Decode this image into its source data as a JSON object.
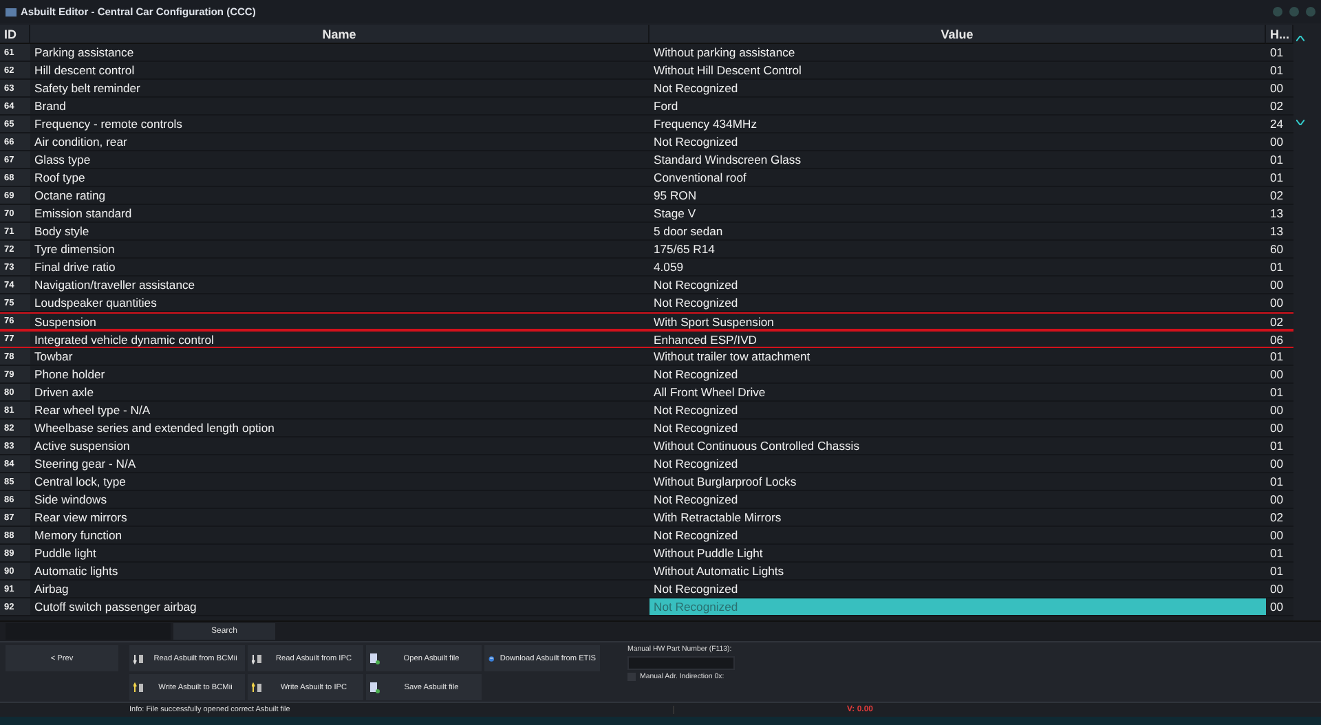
{
  "window": {
    "title": "Asbuilt Editor - Central Car Configuration (CCC)"
  },
  "table": {
    "columns": [
      "ID",
      "Name",
      "Value",
      "H..."
    ],
    "rows": [
      {
        "id": "61",
        "name": "Parking assistance",
        "value": "Without parking assistance",
        "hex": "01",
        "selected": false,
        "highlighted": false
      },
      {
        "id": "62",
        "name": "Hill descent control",
        "value": "Without Hill Descent Control",
        "hex": "01",
        "selected": false,
        "highlighted": false
      },
      {
        "id": "63",
        "name": "Safety belt reminder",
        "value": "Not Recognized",
        "hex": "00",
        "selected": false,
        "highlighted": false
      },
      {
        "id": "64",
        "name": "Brand",
        "value": "Ford",
        "hex": "02",
        "selected": false,
        "highlighted": false
      },
      {
        "id": "65",
        "name": "Frequency - remote controls",
        "value": "Frequency 434MHz",
        "hex": "24",
        "selected": false,
        "highlighted": false
      },
      {
        "id": "66",
        "name": "Air condition, rear",
        "value": "Not Recognized",
        "hex": "00",
        "selected": false,
        "highlighted": false
      },
      {
        "id": "67",
        "name": "Glass type",
        "value": "Standard Windscreen Glass",
        "hex": "01",
        "selected": false,
        "highlighted": false
      },
      {
        "id": "68",
        "name": "Roof type",
        "value": "Conventional roof",
        "hex": "01",
        "selected": false,
        "highlighted": false
      },
      {
        "id": "69",
        "name": "Octane rating",
        "value": "95 RON",
        "hex": "02",
        "selected": false,
        "highlighted": false
      },
      {
        "id": "70",
        "name": "Emission standard",
        "value": "Stage V",
        "hex": "13",
        "selected": false,
        "highlighted": false
      },
      {
        "id": "71",
        "name": "Body style",
        "value": "5 door sedan",
        "hex": "13",
        "selected": false,
        "highlighted": false
      },
      {
        "id": "72",
        "name": "Tyre dimension",
        "value": "175/65 R14",
        "hex": "60",
        "selected": false,
        "highlighted": false
      },
      {
        "id": "73",
        "name": "Final drive ratio",
        "value": "4.059",
        "hex": "01",
        "selected": false,
        "highlighted": false
      },
      {
        "id": "74",
        "name": "Navigation/traveller assistance",
        "value": "Not Recognized",
        "hex": "00",
        "selected": false,
        "highlighted": false
      },
      {
        "id": "75",
        "name": "Loudspeaker quantities",
        "value": "Not Recognized",
        "hex": "00",
        "selected": false,
        "highlighted": false
      },
      {
        "id": "76",
        "name": "Suspension",
        "value": "With Sport Suspension",
        "hex": "02",
        "selected": false,
        "highlighted": true
      },
      {
        "id": "77",
        "name": "Integrated vehicle dynamic control",
        "value": "Enhanced ESP/IVD",
        "hex": "06",
        "selected": false,
        "highlighted": true
      },
      {
        "id": "78",
        "name": "Towbar",
        "value": "Without trailer tow attachment",
        "hex": "01",
        "selected": false,
        "highlighted": false
      },
      {
        "id": "79",
        "name": "Phone holder",
        "value": "Not Recognized",
        "hex": "00",
        "selected": false,
        "highlighted": false
      },
      {
        "id": "80",
        "name": "Driven axle",
        "value": "All Front Wheel Drive",
        "hex": "01",
        "selected": false,
        "highlighted": false
      },
      {
        "id": "81",
        "name": "Rear wheel type - N/A",
        "value": "Not Recognized",
        "hex": "00",
        "selected": false,
        "highlighted": false
      },
      {
        "id": "82",
        "name": "Wheelbase series and extended length option",
        "value": "Not Recognized",
        "hex": "00",
        "selected": false,
        "highlighted": false
      },
      {
        "id": "83",
        "name": "Active suspension",
        "value": "Without Continuous Controlled Chassis",
        "hex": "01",
        "selected": false,
        "highlighted": false
      },
      {
        "id": "84",
        "name": "Steering gear - N/A",
        "value": "Not Recognized",
        "hex": "00",
        "selected": false,
        "highlighted": false
      },
      {
        "id": "85",
        "name": "Central lock, type",
        "value": "Without Burglarproof Locks",
        "hex": "01",
        "selected": false,
        "highlighted": false
      },
      {
        "id": "86",
        "name": "Side windows",
        "value": "Not Recognized",
        "hex": "00",
        "selected": false,
        "highlighted": false
      },
      {
        "id": "87",
        "name": "Rear view mirrors",
        "value": "With Retractable Mirrors",
        "hex": "02",
        "selected": false,
        "highlighted": false
      },
      {
        "id": "88",
        "name": "Memory function",
        "value": "Not Recognized",
        "hex": "00",
        "selected": false,
        "highlighted": false
      },
      {
        "id": "89",
        "name": "Puddle light",
        "value": "Without Puddle Light",
        "hex": "01",
        "selected": false,
        "highlighted": false
      },
      {
        "id": "90",
        "name": "Automatic lights",
        "value": "Without Automatic Lights",
        "hex": "01",
        "selected": false,
        "highlighted": false
      },
      {
        "id": "91",
        "name": "Airbag",
        "value": "Not Recognized",
        "hex": "00",
        "selected": false,
        "highlighted": false
      },
      {
        "id": "92",
        "name": "Cutoff switch passenger airbag",
        "value": "Not Recognized",
        "hex": "00",
        "selected": true,
        "highlighted": false
      }
    ]
  },
  "search": {
    "button": "Search"
  },
  "buttons": [
    {
      "label": "< Prev",
      "kind": "nav"
    },
    {
      "label": "Read Asbuilt from BCMii",
      "kind": "read"
    },
    {
      "label": "Read Asbuilt from IPC",
      "kind": "read"
    },
    {
      "label": "Open Asbuilt file",
      "kind": "file"
    },
    {
      "label": "Download Asbuilt from ETIS",
      "kind": "web"
    },
    {
      "label": "Write Asbuilt to BCMii",
      "kind": "write"
    },
    {
      "label": "Write Asbuilt  to IPC",
      "kind": "write"
    },
    {
      "label": "Save Asbuilt file",
      "kind": "file"
    }
  ],
  "part_number": {
    "label": "Manual HW Part Number (F113):"
  },
  "indirection": {
    "label": "Manual Adr. Indirection 0x:",
    "checked": false
  },
  "status_bar": {
    "info": "Info: File successfully opened correct Asbuilt file",
    "voltage": "V: 0.00"
  }
}
